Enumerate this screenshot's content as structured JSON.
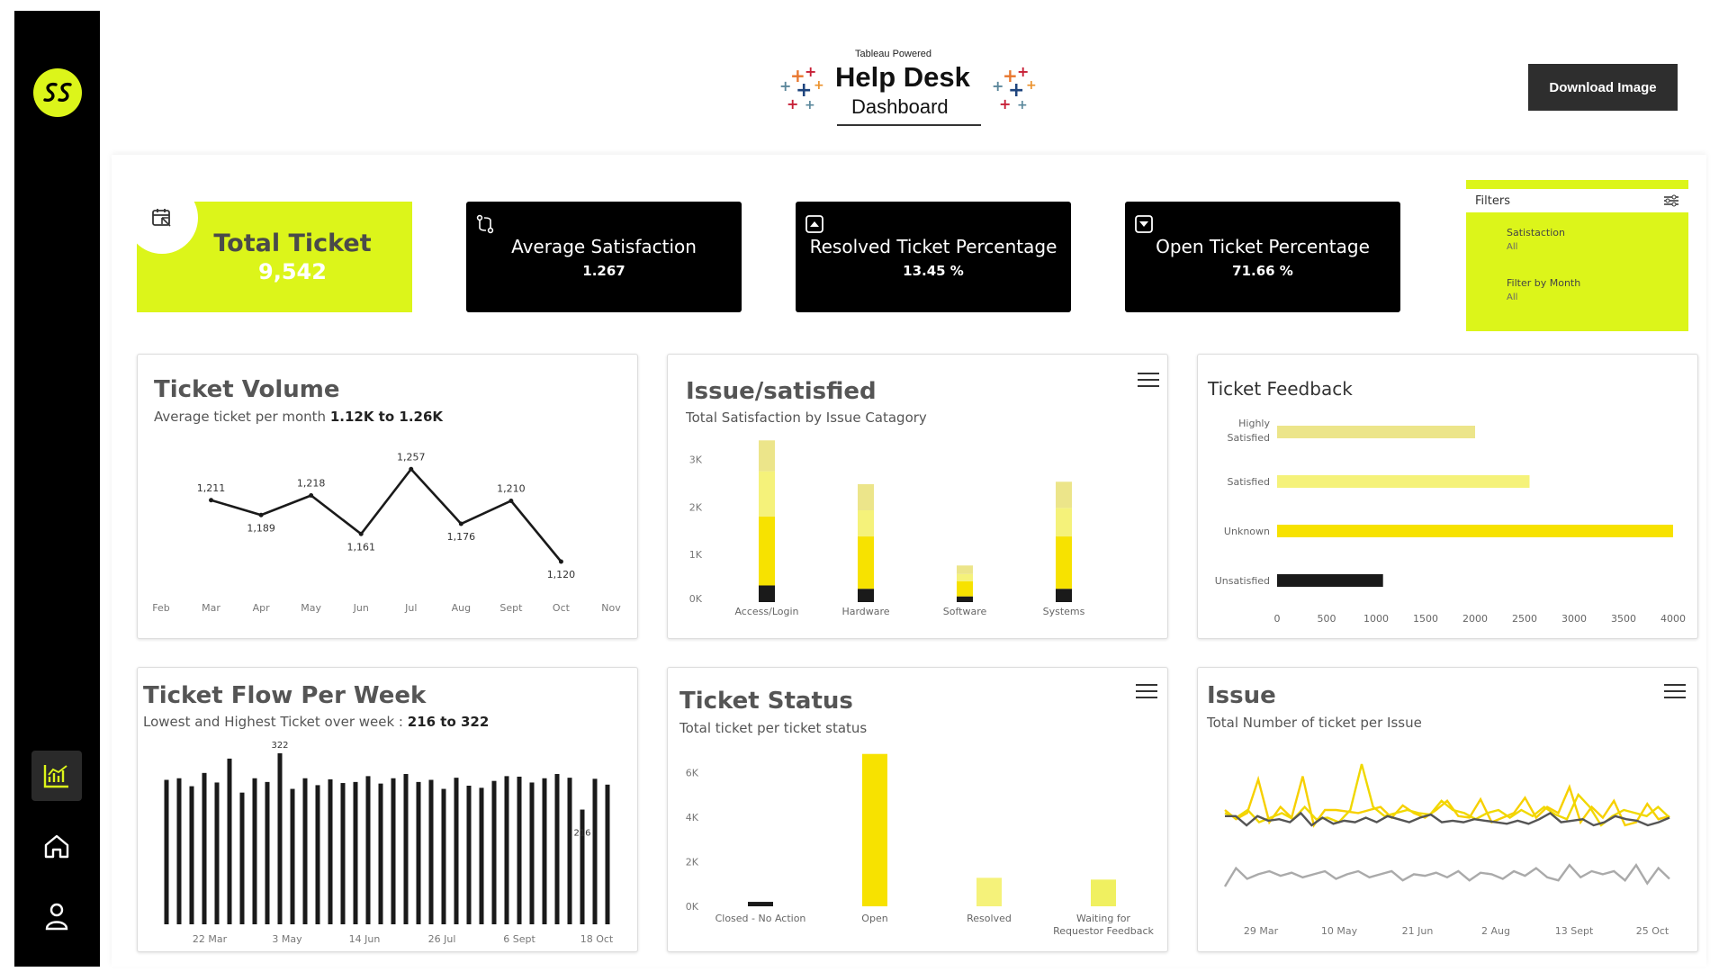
{
  "header": {
    "brand_small": "Tableau Powered",
    "brand_title": "Help Desk",
    "brand_subtitle": "Dashboard",
    "download_label": "Download Image"
  },
  "sidebar": {
    "items": [
      {
        "name": "chart-icon",
        "active": true
      },
      {
        "name": "home-icon",
        "active": false
      },
      {
        "name": "user-icon",
        "active": false
      }
    ]
  },
  "kpis": {
    "total_title": "Total Ticket",
    "total_value": "9,542",
    "avg_title": "Average Satisfaction",
    "avg_value": "1.267",
    "resolved_title": "Resolved Ticket Percentage",
    "resolved_value": "13.45 %",
    "open_title": "Open Ticket Percentage",
    "open_value": "71.66 %"
  },
  "filters": {
    "title": "Filters",
    "satisfaction_label": "Satistaction",
    "satisfaction_value": "All",
    "month_label": "Filter by Month",
    "month_value": "All"
  },
  "panels": {
    "volume": {
      "title": "Ticket Volume",
      "sub": "Average ticket per month ",
      "sub_bold": "1.12K to 1.26K"
    },
    "issue_sat": {
      "title": "Issue/satisfied",
      "sub": "Total Satisfaction by Issue Catagory"
    },
    "feedback": {
      "title": "Ticket Feedback"
    },
    "flow": {
      "title": "Ticket Flow Per Week",
      "sub": "Lowest and Highest Ticket over week : ",
      "sub_bold": "216 to 322"
    },
    "status": {
      "title": "Ticket Status",
      "sub": "Total ticket per ticket status"
    },
    "issue": {
      "title": "Issue",
      "sub": "Total Number of ticket per Issue"
    }
  },
  "colors": {
    "accent": "#dcf51a",
    "dark": "#000000",
    "yellow": "#f7e200",
    "pale": "#f0ec80"
  },
  "chart_data": [
    {
      "id": "ticket-volume",
      "type": "line",
      "x": [
        "Feb",
        "Mar",
        "Apr",
        "May",
        "Jun",
        "Jul",
        "Aug",
        "Sept",
        "Oct",
        "Nov"
      ],
      "series": [
        {
          "values": [
            null,
            1211,
            1189,
            1218,
            1161,
            1257,
            1176,
            1210,
            1120,
            null
          ]
        }
      ],
      "labels": [
        "1,211",
        "1,189",
        "1,218",
        "1,161",
        "1,257",
        "1,176",
        "1,210",
        "1,120"
      ],
      "ylim": [
        1100,
        1270
      ]
    },
    {
      "id": "issue-satisfied",
      "type": "bar",
      "categories": [
        "Access/Login",
        "Hardware",
        "Software",
        "Systems"
      ],
      "yticks": [
        "0K",
        "1K",
        "2K",
        "3K"
      ],
      "ylim": [
        0,
        3500
      ],
      "series": [
        {
          "values": [
            350,
            280,
            120,
            280
          ],
          "color": "#1a1a1a"
        },
        {
          "values": [
            1450,
            1100,
            320,
            1100
          ],
          "color": "#f7e200"
        },
        {
          "values": [
            950,
            550,
            150,
            600
          ],
          "color": "#f5f27a"
        },
        {
          "values": [
            650,
            550,
            180,
            550
          ],
          "color": "#ece58a"
        }
      ]
    },
    {
      "id": "ticket-feedback",
      "type": "bar",
      "orientation": "horizontal",
      "categories": [
        "Highly Satisfied",
        "Satisfied",
        "Unknown",
        "Unsatisfied"
      ],
      "values": [
        2000,
        2550,
        4000,
        1070
      ],
      "bar_colors": [
        "#ece58a",
        "#f5f27a",
        "#f7e200",
        "#1a1a1a"
      ],
      "xticks": [
        "0",
        "500",
        "1000",
        "1500",
        "2000",
        "2500",
        "3000",
        "3500",
        "4000"
      ],
      "xlim": [
        0,
        4000
      ]
    },
    {
      "id": "ticket-flow",
      "type": "bar",
      "x_labels": [
        "22 Mar",
        "3 May",
        "14 Jun",
        "26 Jul",
        "6 Sept",
        "18 Oct"
      ],
      "values": [
        272,
        275,
        260,
        285,
        267,
        312,
        248,
        275,
        268,
        322,
        255,
        275,
        262,
        273,
        266,
        268,
        279,
        265,
        275,
        283,
        268,
        272,
        255,
        276,
        261,
        257,
        270,
        279,
        278,
        267,
        275,
        283,
        276,
        216,
        274,
        263
      ],
      "annotations": [
        {
          "index": 9,
          "label": "322"
        },
        {
          "index": 33,
          "label": "216"
        }
      ],
      "ylim": [
        0,
        330
      ]
    },
    {
      "id": "ticket-status",
      "type": "bar",
      "categories": [
        "Closed - No Action",
        "Open",
        "Resolved",
        "Waiting for Requestor Feedback"
      ],
      "values": [
        200,
        6850,
        1280,
        1200
      ],
      "bar_colors": [
        "#1a1a1a",
        "#f7e200",
        "#f5f27a",
        "#f0f060"
      ],
      "yticks": [
        "0K",
        "2K",
        "4K",
        "6K"
      ],
      "ylim": [
        0,
        7000
      ]
    },
    {
      "id": "issue-lines",
      "type": "line",
      "x_labels": [
        "29 Mar",
        "10 May",
        "21 Jun",
        "2 Aug",
        "13 Sept",
        "25 Oct"
      ],
      "series": [
        {
          "color": "#f7d000",
          "values": [
            60,
            54,
            58,
            80,
            52,
            62,
            55,
            82,
            50,
            60,
            60,
            59,
            58,
            60,
            62,
            55,
            63,
            58,
            55,
            60,
            66,
            56,
            55,
            67,
            52,
            55,
            58,
            68,
            55,
            62,
            58,
            75,
            52,
            62,
            55,
            66,
            50,
            52,
            64,
            54,
            56
          ]
        },
        {
          "color": "#f0d800",
          "values": [
            58,
            55,
            60,
            52,
            55,
            58,
            54,
            62,
            54,
            55,
            52,
            60,
            90,
            62,
            56,
            58,
            60,
            58,
            57,
            66,
            60,
            58,
            54,
            58,
            60,
            55,
            60,
            56,
            62,
            57,
            54,
            70,
            62,
            50,
            56,
            60,
            58,
            56,
            62,
            55
          ]
        },
        {
          "color": "#555555",
          "values": [
            56,
            56,
            50,
            56,
            53,
            54,
            52,
            58,
            50,
            55,
            51,
            53,
            52,
            55,
            52,
            56,
            54,
            52,
            55,
            57,
            52,
            53,
            52,
            54,
            53,
            52,
            51,
            53,
            51,
            54,
            58,
            52,
            53,
            54,
            50,
            52,
            56,
            54,
            53,
            50,
            52,
            55
          ]
        },
        {
          "color": "#aaaaaa",
          "values": [
            10,
            22,
            15,
            18,
            20,
            17,
            19,
            16,
            18,
            20,
            15,
            18,
            20,
            16,
            18,
            20,
            14,
            18,
            17,
            19,
            16,
            20,
            14,
            19,
            18,
            15,
            20,
            17,
            22,
            16,
            14,
            24,
            16,
            20,
            18,
            20,
            14,
            24,
            12,
            22,
            15
          ]
        }
      ],
      "ylim": [
        0,
        100
      ]
    }
  ]
}
